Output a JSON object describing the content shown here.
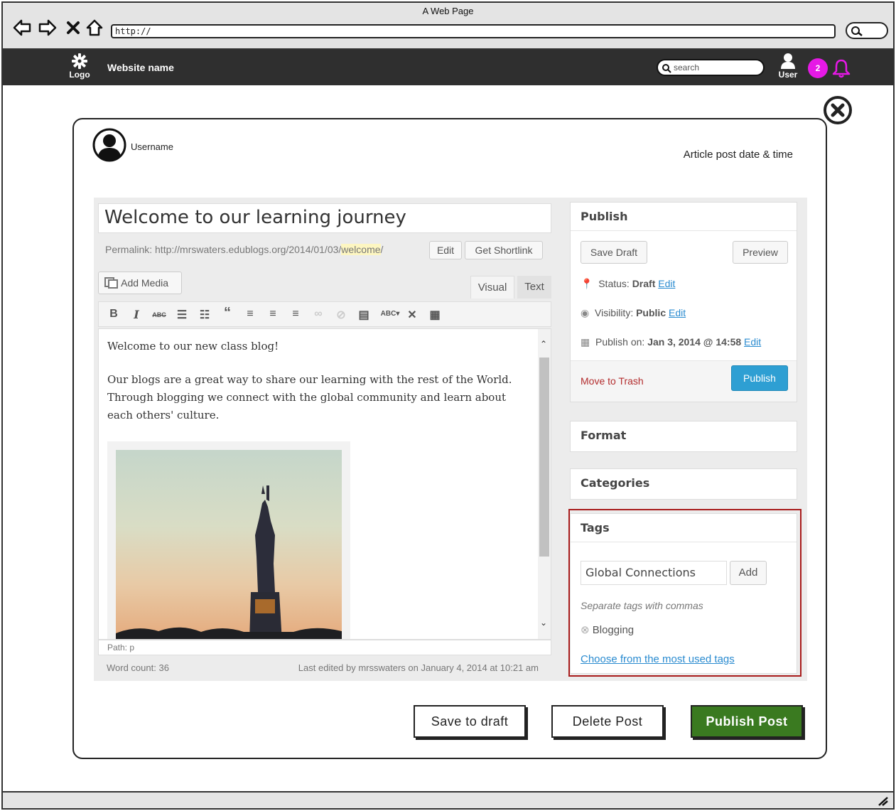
{
  "browser": {
    "title": "A Web Page",
    "url": "http://"
  },
  "site": {
    "logo_label": "Logo",
    "name": "Website name",
    "search_placeholder": "search",
    "user_label": "User",
    "notification_count": "2"
  },
  "modal": {
    "username": "Username",
    "post_date_label": "Article post date & time"
  },
  "editor": {
    "title": "Welcome to our learning journey",
    "permalink_prefix": "Permalink: http://mrswaters.edublogs.org/2014/01/03/",
    "permalink_slug": "welcome",
    "permalink_suffix": "/",
    "edit_label": "Edit",
    "shortlink_label": "Get Shortlink",
    "add_media_label": "Add Media",
    "tab_visual": "Visual",
    "tab_text": "Text",
    "paragraph_1": "Welcome to our new class blog!",
    "paragraph_2": "Our blogs are a great way to share our learning with the rest of the World. Through blogging we connect with the global community and learn about each others' culture.",
    "path": "Path: p",
    "word_count": "Word count: 36",
    "last_edited": "Last edited by mrsswaters on January 4, 2014 at 10:21 am",
    "toolbar_icons": [
      "bold-icon",
      "italic-icon",
      "strikethrough-icon",
      "bullet-list-icon",
      "numbered-list-icon",
      "blockquote-icon",
      "align-left-icon",
      "align-center-icon",
      "align-right-icon",
      "link-icon",
      "unlink-icon",
      "more-tag-icon",
      "spellcheck-icon",
      "fullscreen-icon",
      "kitchen-sink-icon"
    ]
  },
  "publish": {
    "header": "Publish",
    "save_draft": "Save Draft",
    "preview": "Preview",
    "status_label": "Status: ",
    "status_value": "Draft",
    "visibility_label": "Visibility: ",
    "visibility_value": "Public",
    "publish_on_label": "Publish on: ",
    "publish_on_value": "Jan 3, 2014 @ 14:58",
    "edit": "Edit",
    "move_to_trash": "Move to Trash",
    "publish_button": "Publish"
  },
  "format": {
    "header": "Format"
  },
  "categories": {
    "header": "Categories"
  },
  "tags": {
    "header": "Tags",
    "input_value": "Global Connections",
    "add_label": "Add",
    "hint": "Separate tags with commas",
    "existing_tag": "Blogging",
    "choose_link": "Choose from the most used tags"
  },
  "actions": {
    "save_to_draft": "Save to draft",
    "delete_post": "Delete Post",
    "publish_post": "Publish Post"
  },
  "colors": {
    "header_bg": "#2f2f2f",
    "notification": "#e619e6",
    "publish_blue": "#2e9fd3",
    "publish_post_green": "#3a7a20",
    "tags_highlight": "#a81c1c"
  }
}
